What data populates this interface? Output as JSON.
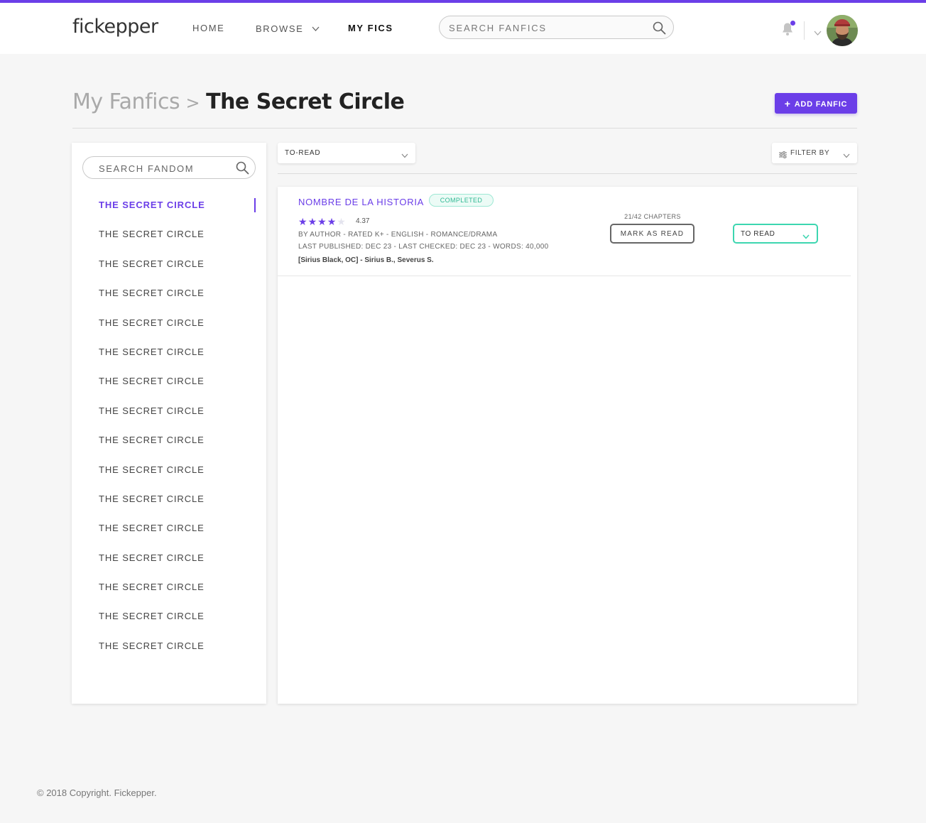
{
  "header": {
    "logo": "fickepper",
    "nav": {
      "home": "HOME",
      "browse": "BROWSE",
      "my_fics": "MY FICS"
    },
    "search_placeholder": "SEARCH FANFICS",
    "accent_color": "#6b3ee8"
  },
  "page": {
    "breadcrumb_root": "My Fanfics",
    "breadcrumb_sep": ">",
    "breadcrumb_current": "The Secret Circle",
    "add_button": "ADD FANFIC"
  },
  "sidebar": {
    "search_placeholder": "SEARCH FANDOM",
    "items": [
      {
        "label": "THE SECRET CIRCLE",
        "active": true
      },
      {
        "label": "THE SECRET CIRCLE"
      },
      {
        "label": "THE SECRET CIRCLE"
      },
      {
        "label": "THE SECRET CIRCLE"
      },
      {
        "label": "THE SECRET CIRCLE"
      },
      {
        "label": "THE SECRET CIRCLE"
      },
      {
        "label": "THE SECRET CIRCLE"
      },
      {
        "label": "THE SECRET CIRCLE"
      },
      {
        "label": "THE SECRET CIRCLE"
      },
      {
        "label": "THE SECRET CIRCLE"
      },
      {
        "label": "THE SECRET CIRCLE"
      },
      {
        "label": "THE SECRET CIRCLE"
      },
      {
        "label": "THE SECRET CIRCLE"
      },
      {
        "label": "THE SECRET CIRCLE"
      },
      {
        "label": "THE SECRET CIRCLE"
      },
      {
        "label": "THE SECRET CIRCLE"
      }
    ]
  },
  "toolbar": {
    "status_filter": "TO-READ",
    "filter_by": "FILTER BY"
  },
  "fics": [
    {
      "title": "NOMBRE DE LA HISTORIA",
      "badge": "COMPLETED",
      "stars_filled": 4,
      "stars_total": 5,
      "rating": "4.37",
      "meta_line1": "BY AUTHOR - RATED K+ - ENGLISH - ROMANCE/DRAMA",
      "meta_line2": "LAST PUBLISHED: DEC 23 - LAST CHECKED: DEC 23 - WORDS: 40,000",
      "characters": "[Sirius Black, OC] - Sirius B., Severus S.",
      "chapters": "21/42 CHAPTERS",
      "mark_button": "MARK AS READ",
      "status": "TO READ"
    }
  ],
  "footer": {
    "copyright": "© 2018 Copyright. Fickepper."
  }
}
